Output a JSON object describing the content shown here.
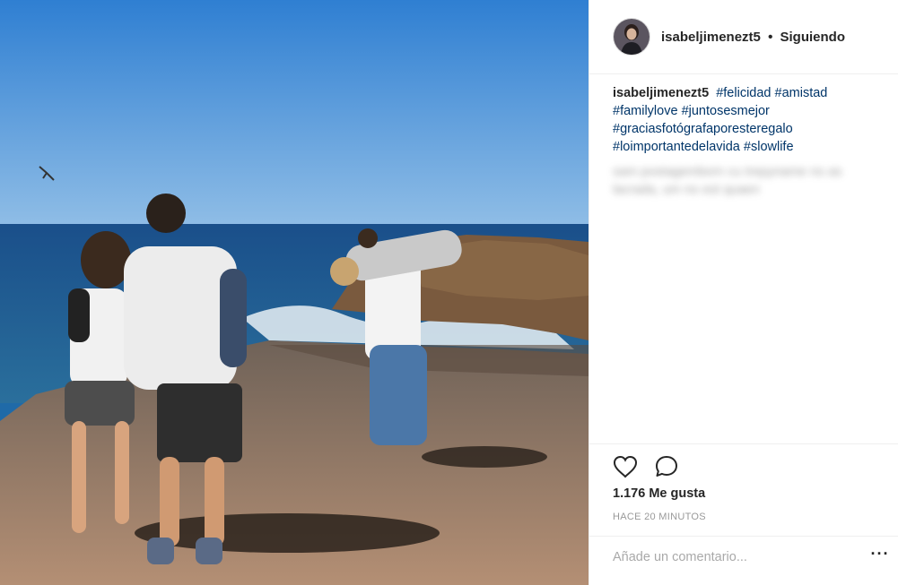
{
  "post": {
    "username": "isabeljimenezt5",
    "separator": "•",
    "follow_label": "Siguiendo",
    "caption_username": "isabeljimenezt5",
    "hashtags": [
      "#felicidad",
      "#amistad",
      "#familylove",
      "#juntosesmejor",
      "#graciasfotógrafaporesteregalo",
      "#loimportantedelavida",
      "#slowlife"
    ],
    "blurred_comment": "sam postagemborn cu trepyname no as lacrada, um no est quaen",
    "likes": "1.176 Me gusta",
    "time": "HACE 20 MINUTOS",
    "comment_placeholder": "Añade un comentario...",
    "more_label": "···"
  },
  "icons": {
    "like": "heart-icon",
    "comment": "speech-bubble-icon",
    "more": "more-options-icon"
  },
  "colors": {
    "text": "#262626",
    "hashtag": "#003569",
    "muted": "#999999",
    "divider": "#efefef"
  }
}
